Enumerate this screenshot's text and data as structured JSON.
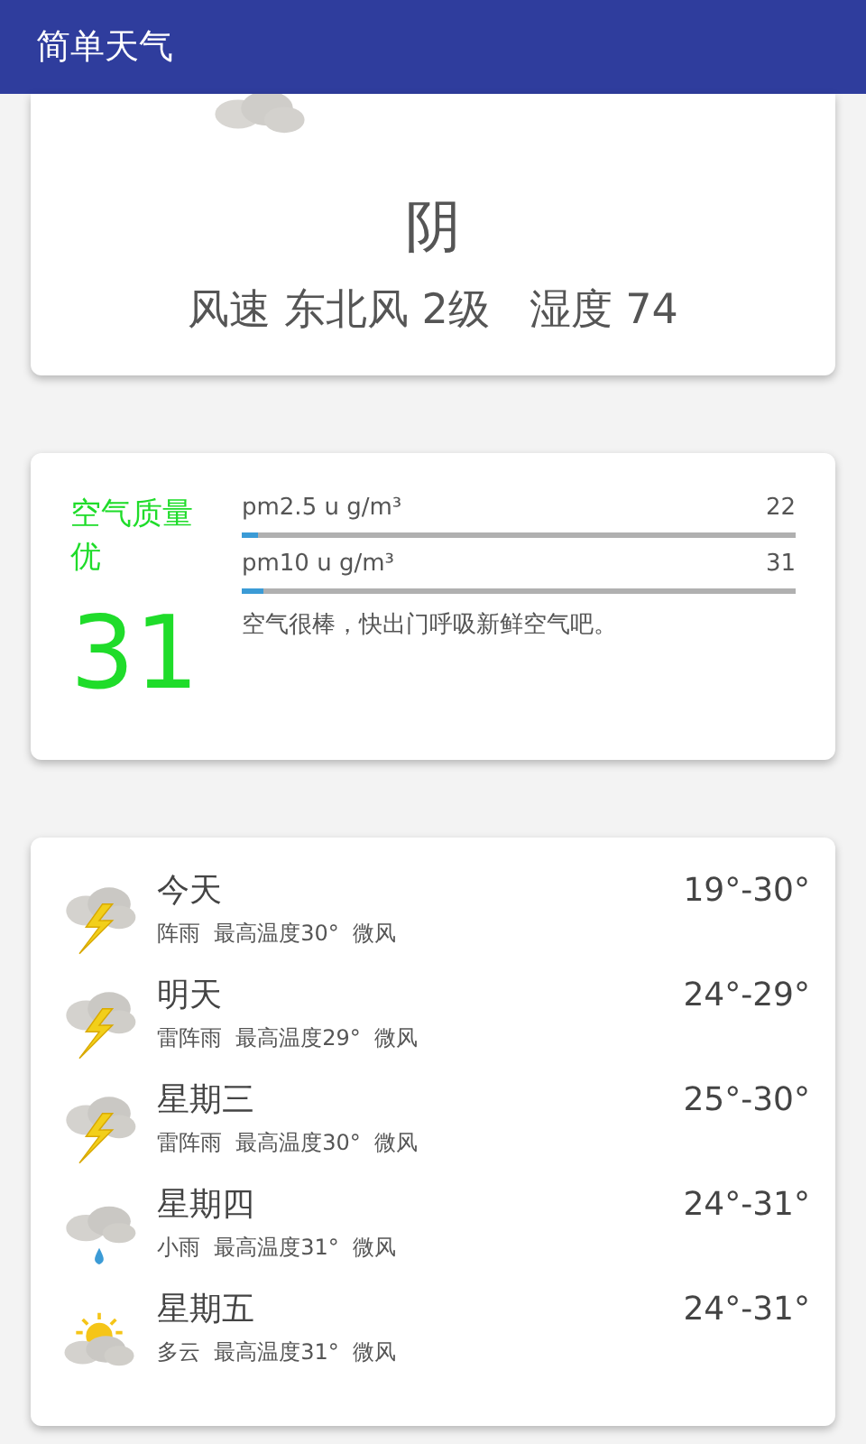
{
  "app_bar": {
    "title": "简单天气"
  },
  "now": {
    "condition": "阴",
    "details": "风速 东北风 2级   湿度 74"
  },
  "air": {
    "label": "空气质量",
    "quality": "优",
    "aqi": "31",
    "pollutants": [
      {
        "name": "pm2.5 u g/m³",
        "value": "22",
        "level": 0.03
      },
      {
        "name": "pm10 u g/m³",
        "value": "31",
        "level": 0.04
      }
    ],
    "advice": "空气很棒，快出门呼吸新鲜空气吧。"
  },
  "forecast": [
    {
      "day": "今天",
      "kind": "thunder",
      "summary": "阵雨  最高温度30°  微风",
      "range": "19°-30°"
    },
    {
      "day": "明天",
      "kind": "thunder",
      "summary": "雷阵雨  最高温度29°  微风",
      "range": "24°-29°"
    },
    {
      "day": "星期三",
      "kind": "thunder",
      "summary": "雷阵雨  最高温度30°  微风",
      "range": "25°-30°"
    },
    {
      "day": "星期四",
      "kind": "rain",
      "summary": "小雨  最高温度31°  微风",
      "range": "24°-31°"
    },
    {
      "day": "星期五",
      "kind": "partly_cloudy",
      "summary": "多云  最高温度31°  微风",
      "range": "24°-31°"
    }
  ]
}
